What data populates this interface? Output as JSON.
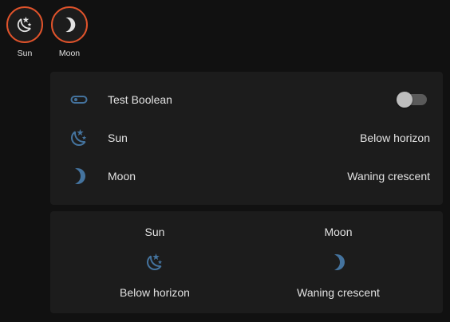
{
  "colors": {
    "background": "#111111",
    "card": "#1c1c1c",
    "accent_border": "#e0532b",
    "icon": "#44739e",
    "text": "#e1e1e1"
  },
  "badges": [
    {
      "label": "Sun",
      "icon": "weather-night-icon"
    },
    {
      "label": "Moon",
      "icon": "moon-icon"
    }
  ],
  "entities": {
    "rows": [
      {
        "name": "Test Boolean",
        "icon": "toggle-switch-icon",
        "state_on": false
      },
      {
        "name": "Sun",
        "icon": "weather-night-icon",
        "state": "Below horizon"
      },
      {
        "name": "Moon",
        "icon": "moon-icon",
        "state": "Waning crescent"
      }
    ]
  },
  "glance": {
    "items": [
      {
        "name": "Sun",
        "icon": "weather-night-icon",
        "state": "Below horizon"
      },
      {
        "name": "Moon",
        "icon": "moon-icon",
        "state": "Waning crescent"
      }
    ]
  }
}
